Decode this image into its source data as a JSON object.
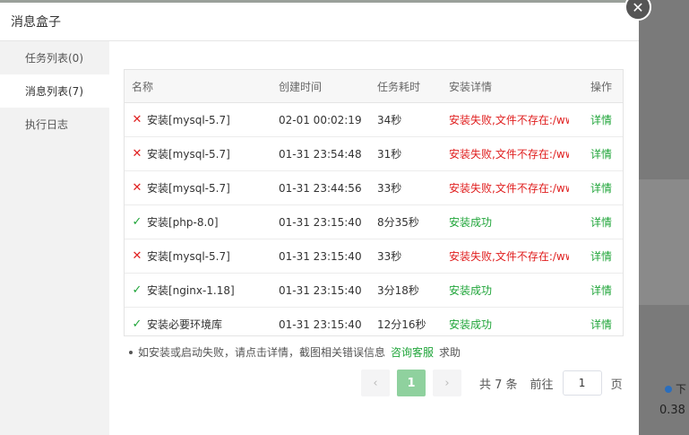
{
  "dialog": {
    "title": "消息盒子",
    "close_icon": "close-icon"
  },
  "sidebar": {
    "items": [
      {
        "label": "任务列表(0)"
      },
      {
        "label": "消息列表(7)"
      },
      {
        "label": "执行日志"
      }
    ]
  },
  "table": {
    "headers": {
      "name": "名称",
      "created": "创建时间",
      "duration": "任务耗时",
      "detail": "安装详情",
      "op": "操作"
    },
    "rows": [
      {
        "status": "fail",
        "name": "安装[mysql-5.7]",
        "created": "02-01 00:02:19",
        "duration": "34秒",
        "detail": "安装失败,文件不存在:/www",
        "op": "详情"
      },
      {
        "status": "fail",
        "name": "安装[mysql-5.7]",
        "created": "01-31 23:54:48",
        "duration": "31秒",
        "detail": "安装失败,文件不存在:/www",
        "op": "详情"
      },
      {
        "status": "fail",
        "name": "安装[mysql-5.7]",
        "created": "01-31 23:44:56",
        "duration": "33秒",
        "detail": "安装失败,文件不存在:/www",
        "op": "详情"
      },
      {
        "status": "ok",
        "name": "安装[php-8.0]",
        "created": "01-31 23:15:40",
        "duration": "8分35秒",
        "detail": "安装成功",
        "op": "详情"
      },
      {
        "status": "fail",
        "name": "安装[mysql-5.7]",
        "created": "01-31 23:15:40",
        "duration": "33秒",
        "detail": "安装失败,文件不存在:/www",
        "op": "详情"
      },
      {
        "status": "ok",
        "name": "安装[nginx-1.18]",
        "created": "01-31 23:15:40",
        "duration": "3分18秒",
        "detail": "安装成功",
        "op": "详情"
      },
      {
        "status": "ok",
        "name": "安装必要环境库",
        "created": "01-31 23:15:40",
        "duration": "12分16秒",
        "detail": "安装成功",
        "op": "详情"
      }
    ]
  },
  "tip": {
    "text": "如安装或启动失败，请点击详情，截图相关错误信息",
    "link": "咨询客服",
    "suffix": "求助"
  },
  "pagination": {
    "prev": "‹",
    "page": "1",
    "next": "›",
    "total": "共 7 条",
    "goto": "前往",
    "input_value": "1",
    "page_unit": "页"
  },
  "background": {
    "legend_text": "下",
    "value": "0.38"
  },
  "colors": {
    "success": "#20a53a",
    "fail": "#e02020",
    "page_active": "#8fd19e"
  }
}
